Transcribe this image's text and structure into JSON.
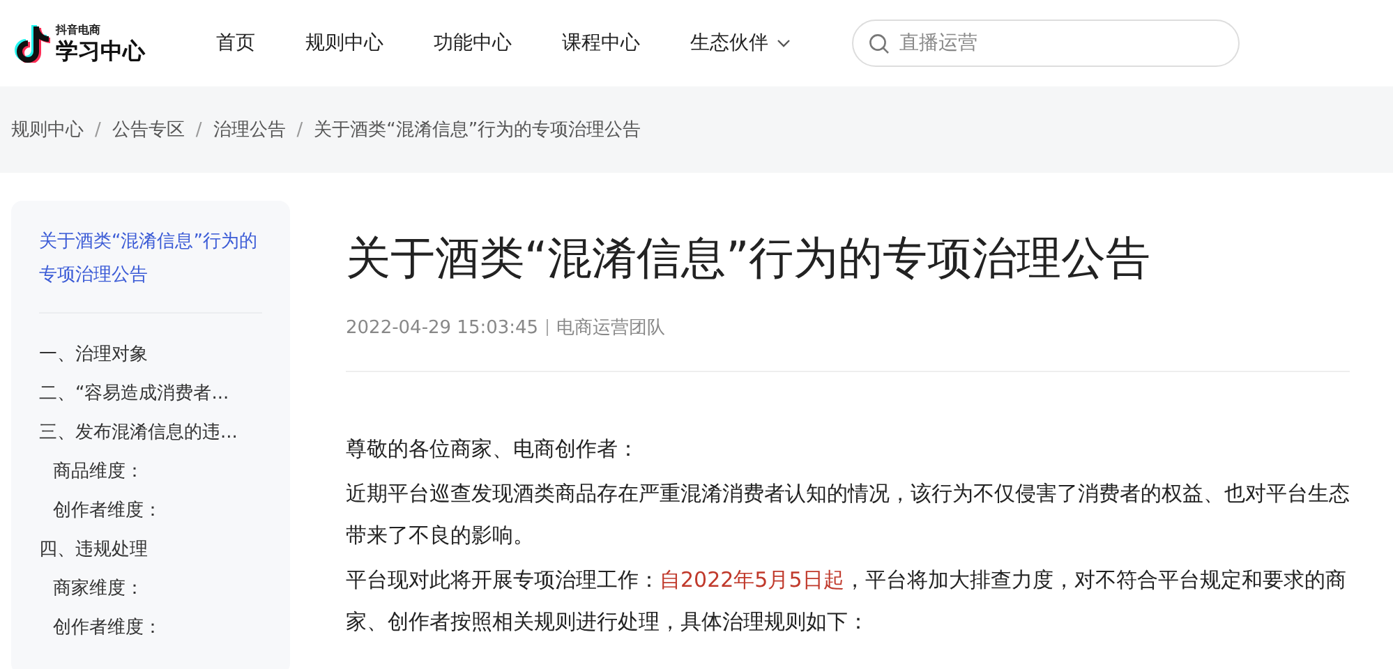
{
  "logo": {
    "subtitle": "抖音电商",
    "title": "学习中心"
  },
  "nav": [
    {
      "label": "首页",
      "dropdown": false
    },
    {
      "label": "规则中心",
      "dropdown": false
    },
    {
      "label": "功能中心",
      "dropdown": false
    },
    {
      "label": "课程中心",
      "dropdown": false
    },
    {
      "label": "生态伙伴",
      "dropdown": true
    }
  ],
  "search": {
    "placeholder": "直播运营"
  },
  "breadcrumb": [
    {
      "label": "规则中心"
    },
    {
      "separator": "/",
      "label": "公告专区"
    },
    {
      "separator": "/",
      "label": "治理公告"
    },
    {
      "separator": "/",
      "label": "关于酒类“混淆信息”行为的专项治理公告"
    }
  ],
  "toc": {
    "title": {
      "label": "关于酒类“混淆信息”行为的专项治理公告",
      "selected": true
    },
    "items": [
      {
        "label": "一、治理对象",
        "selected": false
      },
      {
        "label": "二、“容易造成消费者...",
        "selected": false
      },
      {
        "label": "三、发布混淆信息的违...",
        "selected": false,
        "children": [
          {
            "label": "商品维度：",
            "selected": false
          },
          {
            "label": "创作者维度：",
            "selected": false
          }
        ]
      },
      {
        "label": "四、违规处理",
        "selected": false,
        "children": [
          {
            "label": "商家维度：",
            "selected": false
          },
          {
            "label": "创作者维度：",
            "selected": false
          }
        ]
      }
    ]
  },
  "article": {
    "title": "关于酒类“混淆信息”行为的专项治理公告",
    "date": "2022-04-29 15:03:45",
    "author": "电商运营团队",
    "paragraphs": [
      [
        {
          "text": "尊敬的各位商家、电商创作者：",
          "highlight": false
        }
      ],
      [
        {
          "text": " 近期平台巡查发现酒类商品存在严重混淆消费者认知的情况，该行为不仅侵害了消费者的权益、也对平台生态带来了不良的影响。",
          "highlight": false
        }
      ],
      [
        {
          "text": " 平台现对此将开展专项治理工作：",
          "highlight": false
        },
        {
          "text": "自2022年5月5日起",
          "highlight": true
        },
        {
          "text": "，平台将加大排查力度，对不符合平台规定和要求的商家、创作者按照相关规则进行处理，具体治理规则如下：",
          "highlight": false
        }
      ]
    ]
  }
}
